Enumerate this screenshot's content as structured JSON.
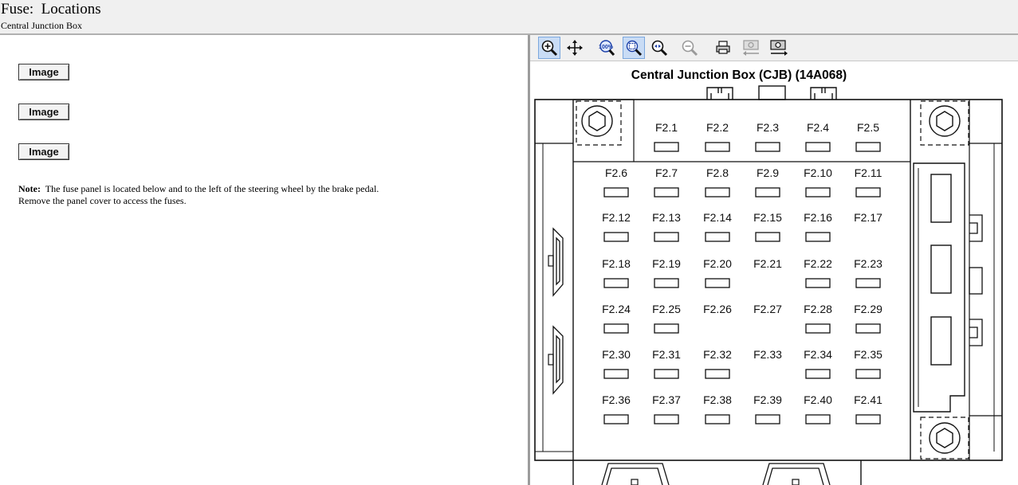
{
  "header": {
    "title": "Fuse:  Locations",
    "subtitle": "Central Junction Box"
  },
  "left": {
    "buttons": [
      "Image",
      "Image",
      "Image"
    ],
    "note_label": "Note:",
    "note_text": "The fuse panel is located below and to the left of the steering wheel by the brake pedal. Remove the panel cover to access the fuses."
  },
  "toolbar": {
    "icons": [
      "zoom-in-icon",
      "pan-icon",
      "actual-size-icon",
      "fit-window-icon",
      "zoom-area-icon",
      "zoom-out-icon",
      "print-icon",
      "copy-image-icon",
      "save-image-icon"
    ]
  },
  "diagram": {
    "title": "Central Junction Box (CJB) (14A068)",
    "fuse_rows": [
      [
        "",
        "F2.1",
        "F2.2",
        "F2.3",
        "F2.4",
        "F2.5"
      ],
      [
        "F2.6",
        "F2.7",
        "F2.8",
        "F2.9",
        "F2.10",
        "F2.11"
      ],
      [
        "F2.12",
        "F2.13",
        "F2.14",
        "F2.15",
        "F2.16",
        "F2.17"
      ],
      [
        "F2.18",
        "F2.19",
        "F2.20",
        "F2.21",
        "F2.22",
        "F2.23"
      ],
      [
        "F2.24",
        "F2.25",
        "F2.26",
        "F2.27",
        "F2.28",
        "F2.29"
      ],
      [
        "F2.30",
        "F2.31",
        "F2.32",
        "F2.33",
        "F2.34",
        "F2.35"
      ],
      [
        "F2.36",
        "F2.37",
        "F2.38",
        "F2.39",
        "F2.40",
        "F2.41"
      ]
    ],
    "empty_slots": [
      "F2.17",
      "F2.21",
      "F2.26",
      "F2.27",
      "F2.33"
    ]
  }
}
